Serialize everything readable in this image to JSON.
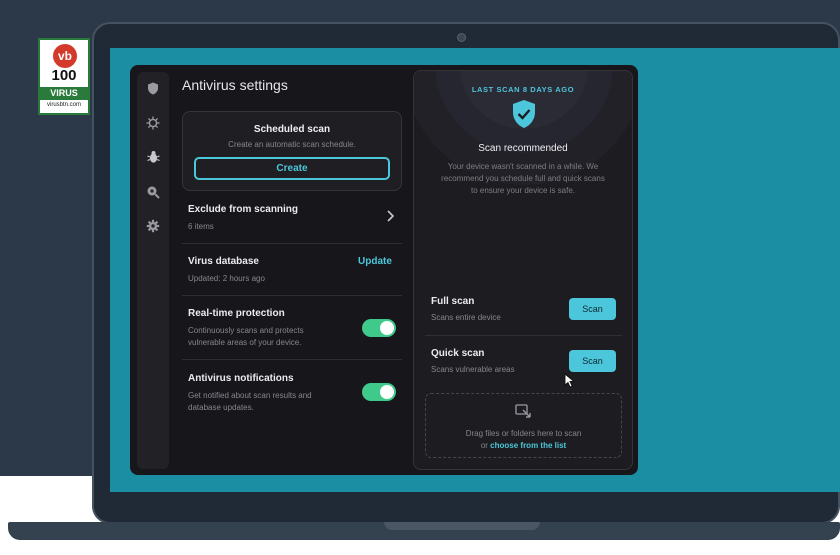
{
  "badge": {
    "logo": "vb",
    "score": "100",
    "category": "VIRUS",
    "site": "virusbtn.com"
  },
  "app": {
    "title": "Antivirus settings",
    "sidebar": {
      "items": [
        {
          "icon": "shield-icon",
          "active": false
        },
        {
          "icon": "virus-icon",
          "active": false
        },
        {
          "icon": "bug-icon",
          "active": true
        },
        {
          "icon": "search-bug-icon",
          "active": false
        },
        {
          "icon": "gear-icon",
          "active": false
        }
      ]
    },
    "scheduled_scan": {
      "title": "Scheduled scan",
      "subtitle": "Create an automatic scan schedule.",
      "button": "Create"
    },
    "settings": {
      "exclude": {
        "title": "Exclude from scanning",
        "subtitle": "6 items"
      },
      "database": {
        "title": "Virus database",
        "subtitle": "Updated: 2 hours ago",
        "action": "Update"
      },
      "realtime": {
        "title": "Real-time protection",
        "subtitle_line1": "Continuously scans and protects",
        "subtitle_line2": "vulnerable areas of your device.",
        "enabled": true
      },
      "notifications": {
        "title": "Antivirus notifications",
        "subtitle_line1": "Get notified about scan results and",
        "subtitle_line2": "database updates.",
        "enabled": true
      }
    },
    "panel": {
      "last_scan": "LAST SCAN 8 DAYS AGO",
      "status_title": "Scan recommended",
      "status_line1": "Your device wasn't scanned in a while. We",
      "status_line2": "recommend you schedule full and quick scans",
      "status_line3": "to ensure your device is safe.",
      "full_scan": {
        "title": "Full scan",
        "subtitle": "Scans entire device",
        "button": "Scan"
      },
      "quick_scan": {
        "title": "Quick scan",
        "subtitle": "Scans vulnerable areas",
        "button": "Scan"
      },
      "drop": {
        "text": "Drag files or folders here to scan",
        "prefix": "or",
        "link": "choose from the list"
      }
    }
  },
  "colors": {
    "accent": "#4cc6da",
    "toggle_on": "#3fc98b",
    "screen": "#1b8ea4",
    "app_bg": "#17171b"
  }
}
